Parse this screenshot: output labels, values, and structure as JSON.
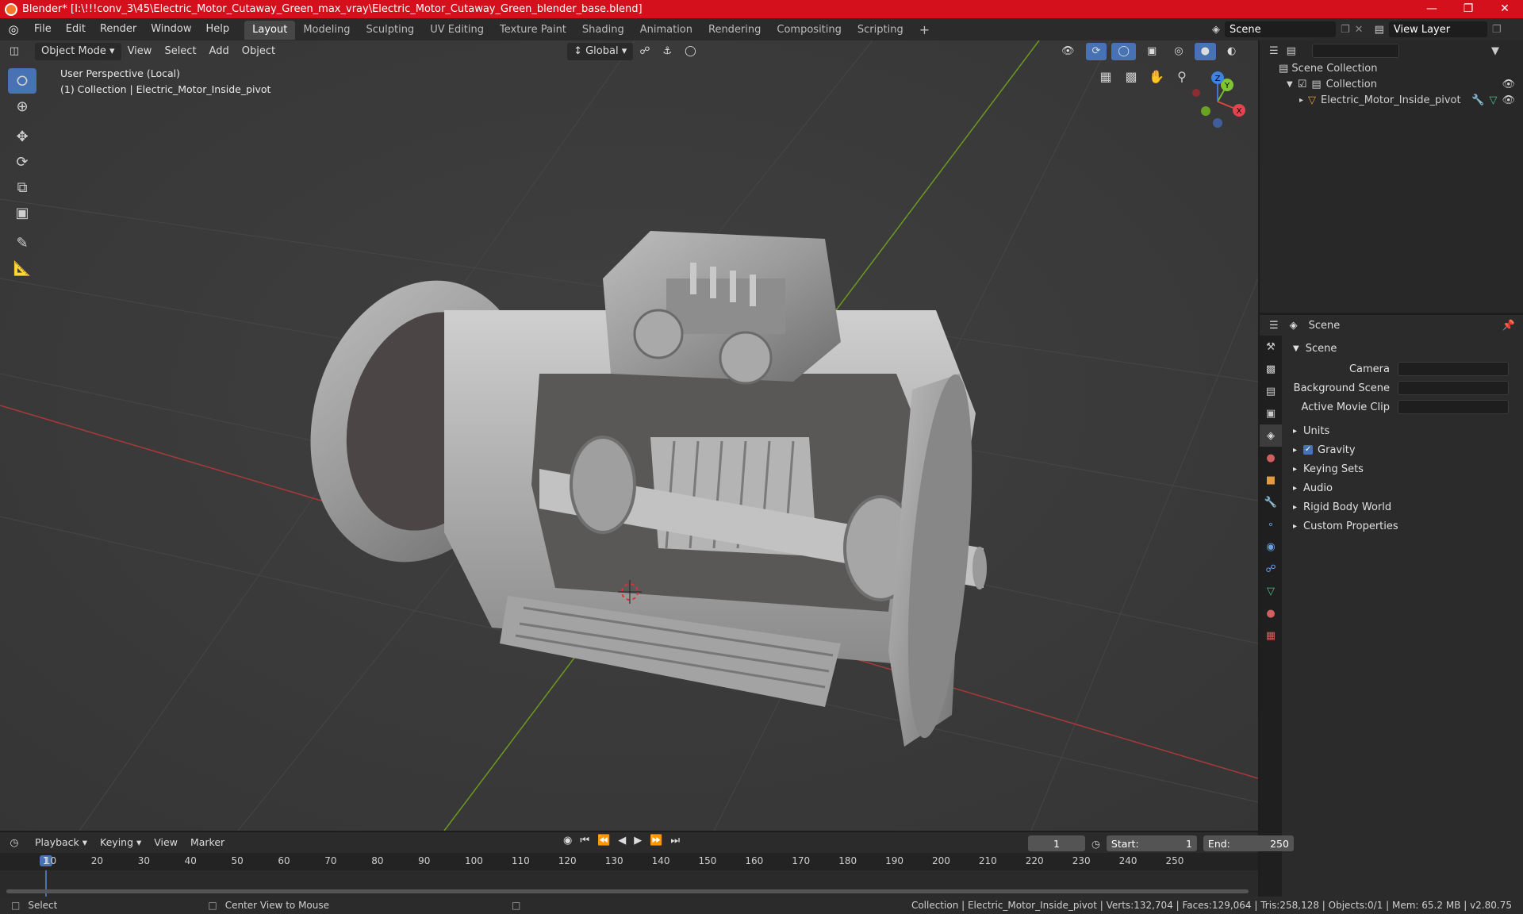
{
  "window": {
    "title": "Blender* [I:\\!!!conv_3\\45\\Electric_Motor_Cutaway_Green_max_vray\\Electric_Motor_Cutaway_Green_blender_base.blend]"
  },
  "menus": [
    "File",
    "Edit",
    "Render",
    "Window",
    "Help"
  ],
  "workspaces": [
    "Layout",
    "Modeling",
    "Sculpting",
    "UV Editing",
    "Texture Paint",
    "Shading",
    "Animation",
    "Rendering",
    "Compositing",
    "Scripting"
  ],
  "scene_field": "Scene",
  "view_layer_field": "View Layer",
  "viewport": {
    "mode": "Object Mode",
    "menus": [
      "View",
      "Select",
      "Add",
      "Object"
    ],
    "orientation": "Global",
    "info_line1": "User Perspective (Local)",
    "info_line2": "(1) Collection | Electric_Motor_Inside_pivot",
    "gizmo": {
      "x": "X",
      "y": "Y",
      "z": "Z"
    }
  },
  "outliner": {
    "root": "Scene Collection",
    "collection": "Collection",
    "object": "Electric_Motor_Inside_pivot"
  },
  "properties": {
    "header": "Scene",
    "panel": "Scene",
    "camera_label": "Camera",
    "background_scene_label": "Background Scene",
    "active_movie_clip_label": "Active Movie Clip",
    "sections": [
      "Units",
      "Gravity",
      "Keying Sets",
      "Audio",
      "Rigid Body World",
      "Custom Properties"
    ]
  },
  "timeline": {
    "menus": [
      "Playback",
      "Keying",
      "View",
      "Marker"
    ],
    "current_frame": "1",
    "start_label": "Start:",
    "start": "1",
    "end_label": "End:",
    "end": "250",
    "ticks": [
      "1",
      "10",
      "20",
      "30",
      "40",
      "50",
      "60",
      "70",
      "80",
      "90",
      "100",
      "110",
      "120",
      "130",
      "140",
      "150",
      "160",
      "170",
      "180",
      "190",
      "200",
      "210",
      "220",
      "230",
      "240",
      "250"
    ]
  },
  "status": {
    "left": "Select",
    "middle": "Center View to Mouse",
    "right": "Collection | Electric_Motor_Inside_pivot | Verts:132,704 | Faces:129,064 | Tris:258,128 | Objects:0/1 | Mem: 65.2 MB | v2.80.75"
  },
  "colors": {
    "title_bar": "#d4101c",
    "accent": "#4772b3",
    "x_axis": "#a83a3a",
    "y_axis": "#6c9a1e"
  }
}
